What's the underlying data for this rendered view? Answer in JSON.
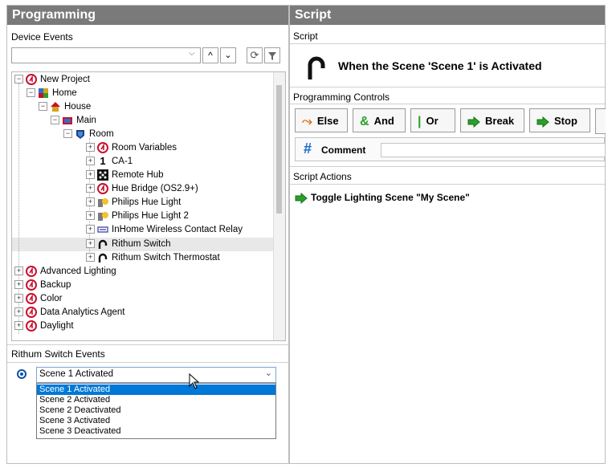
{
  "left_panel": {
    "title": "Programming",
    "device_events_label": "Device Events",
    "search_value": "",
    "tree": [
      {
        "label": "New Project",
        "icon": "control4-icon",
        "level": 0
      },
      {
        "label": "Home",
        "icon": "home-icon",
        "level": 1
      },
      {
        "label": "House",
        "icon": "house-icon",
        "level": 2
      },
      {
        "label": "Main",
        "icon": "floor-icon",
        "level": 3
      },
      {
        "label": "Room",
        "icon": "room-icon",
        "level": 4
      },
      {
        "label": "Room Variables",
        "icon": "control4-icon",
        "level": 5
      },
      {
        "label": "CA-1",
        "icon": "numeral-one-icon",
        "level": 5
      },
      {
        "label": "Remote Hub",
        "icon": "hub-icon",
        "level": 5
      },
      {
        "label": "Hue Bridge (OS2.9+)",
        "icon": "control4-icon",
        "level": 5
      },
      {
        "label": "Philips Hue Light",
        "icon": "light-icon",
        "level": 5
      },
      {
        "label": "Philips Hue Light 2",
        "icon": "light-icon",
        "level": 5
      },
      {
        "label": "InHome Wireless Contact Relay",
        "icon": "relay-icon",
        "level": 5
      },
      {
        "label": "Rithum Switch",
        "icon": "rithum-icon",
        "level": 5
      },
      {
        "label": "Rithum Switch Thermostat",
        "icon": "rithum-icon",
        "level": 5
      },
      {
        "label": "Advanced Lighting",
        "icon": "control4-icon",
        "level": 0
      },
      {
        "label": "Backup",
        "icon": "control4-icon",
        "level": 0
      },
      {
        "label": "Color",
        "icon": "control4-icon",
        "level": 0
      },
      {
        "label": "Data Analytics Agent",
        "icon": "control4-icon",
        "level": 0
      },
      {
        "label": "Daylight",
        "icon": "control4-icon",
        "level": 0
      }
    ],
    "events_label": "Rithum Switch Events",
    "event_selected": "Scene 1 Activated",
    "event_options": [
      "Scene 1 Activated",
      "Scene 2 Activated",
      "Scene 2 Deactivated",
      "Scene 3 Activated",
      "Scene 3 Deactivated"
    ]
  },
  "right_panel": {
    "title": "Script",
    "script_label": "Script",
    "script_title": "When the Scene 'Scene 1' is Activated",
    "controls_label": "Programming Controls",
    "buttons": [
      {
        "label": "Else",
        "icon": "else-icon"
      },
      {
        "label": "And",
        "icon": "and-icon"
      },
      {
        "label": "Or",
        "icon": "or-icon"
      },
      {
        "label": "Break",
        "icon": "break-arrow-icon"
      },
      {
        "label": "Stop",
        "icon": "stop-arrow-icon"
      }
    ],
    "comment_label": "Comment",
    "actions_label": "Script Actions",
    "action_text": "Toggle Lighting Scene \"My Scene\""
  },
  "colors": {
    "header_bg": "#7a7a7a",
    "selection": "#0078d7",
    "control4_red": "#c8102e",
    "green": "#2aa12a"
  }
}
